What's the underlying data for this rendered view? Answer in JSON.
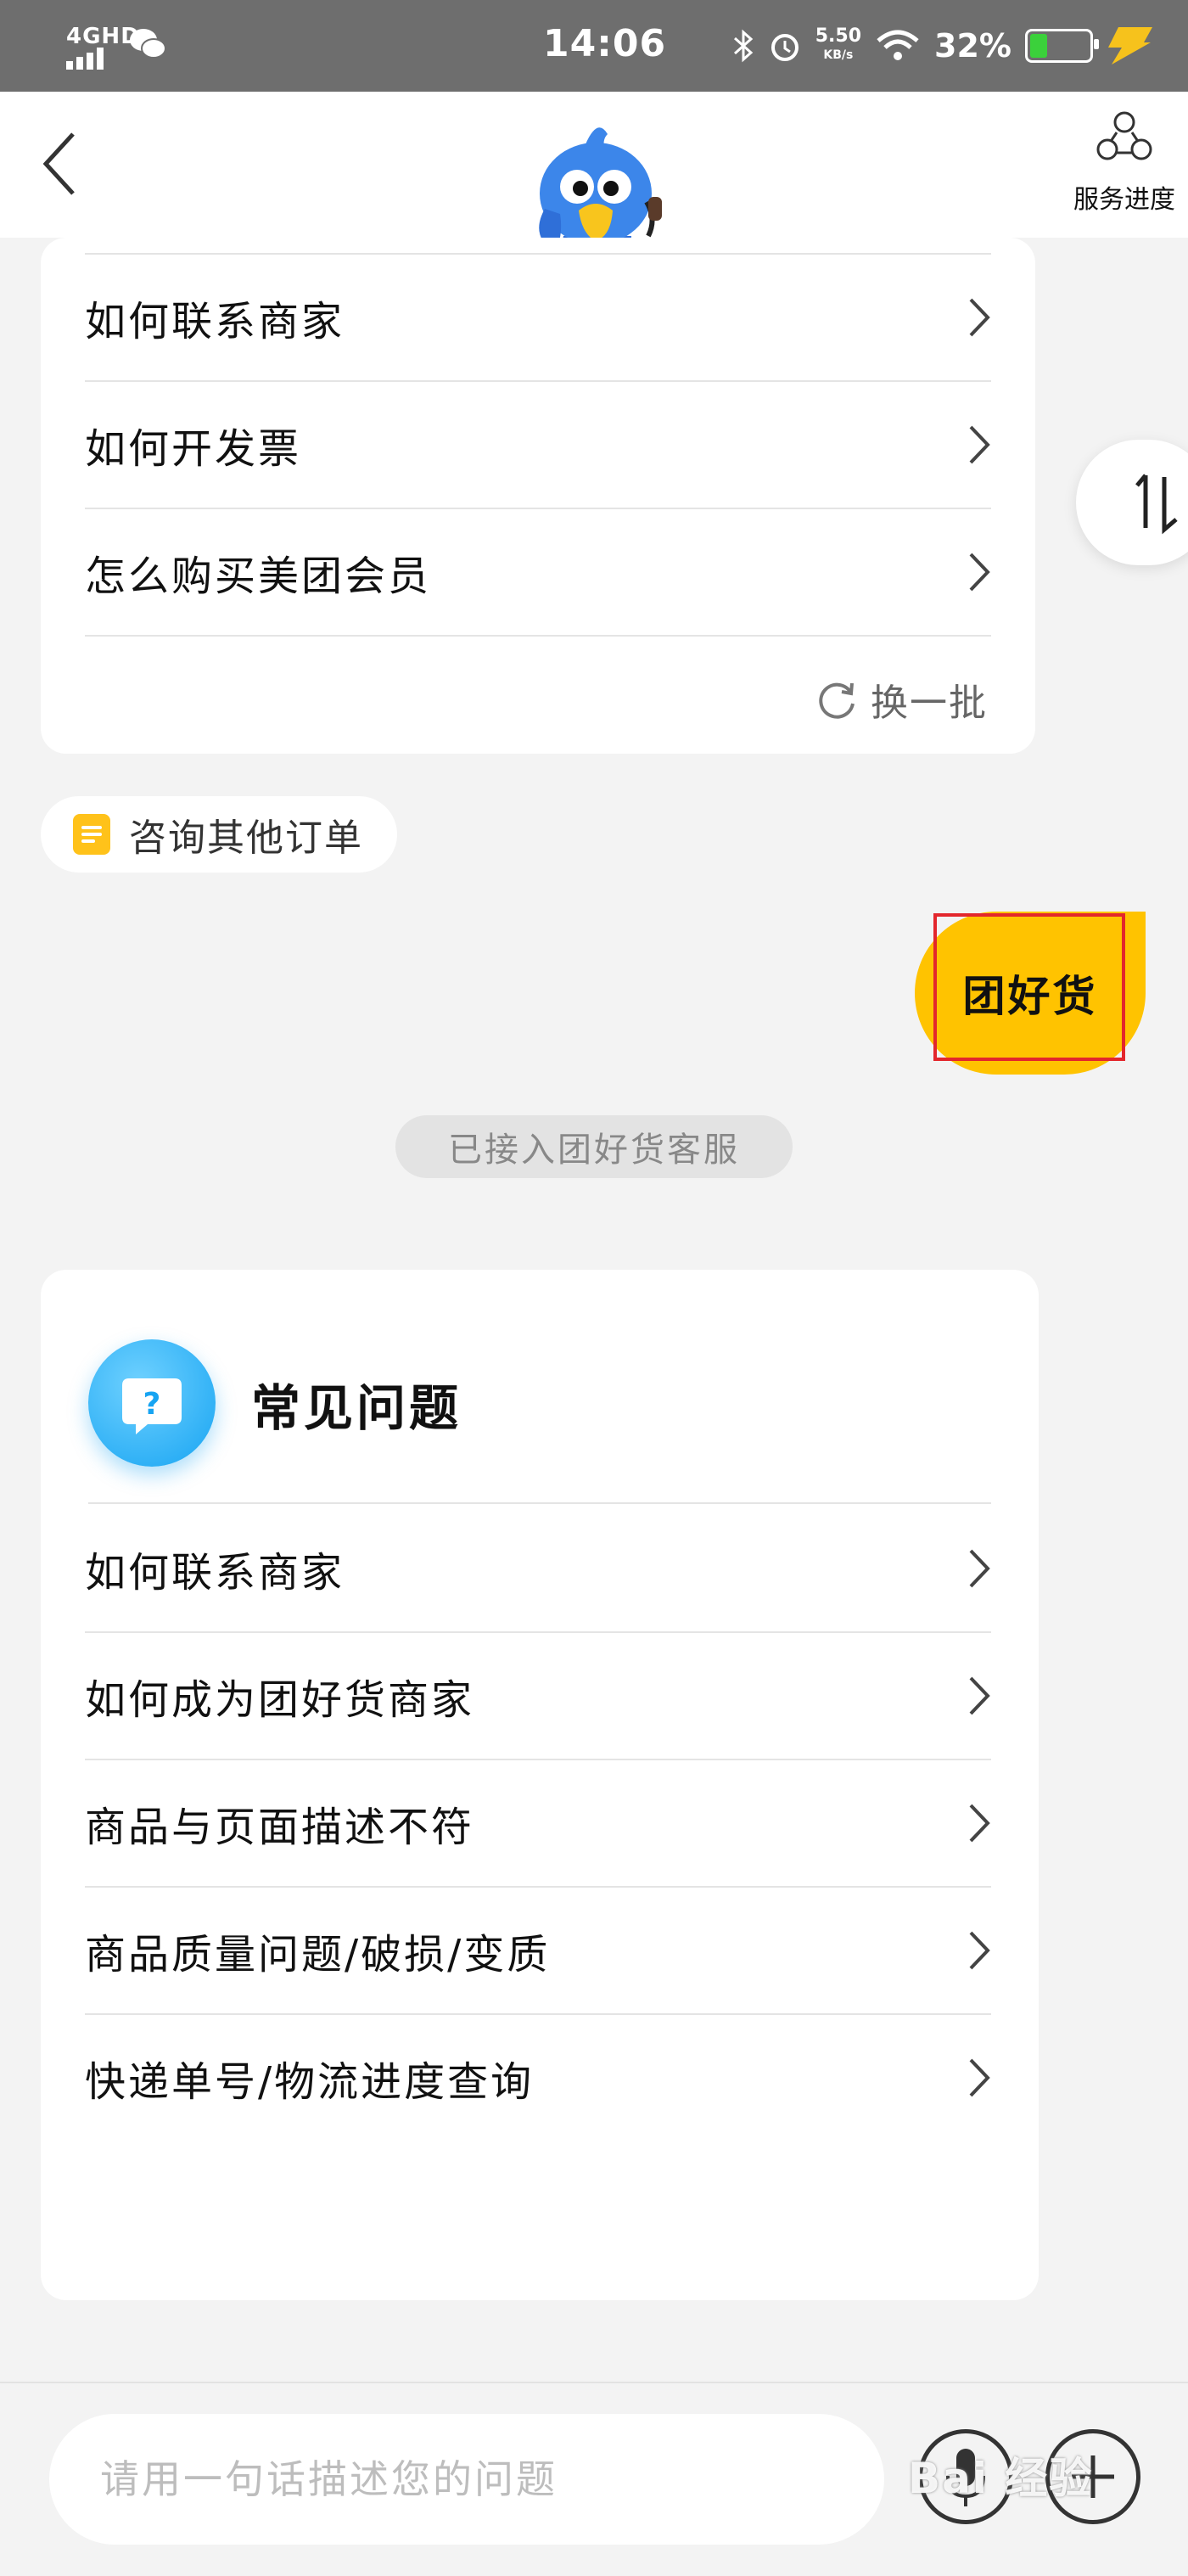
{
  "status_bar": {
    "network": "4GHD",
    "time": "14:06",
    "speed_value": "5.50",
    "speed_unit": "KB/s",
    "battery": "32%",
    "battery_level": 0.32
  },
  "header": {
    "service_progress_label": "服务进度"
  },
  "top_card": {
    "questions": [
      "如何联系商家",
      "如何开发票",
      "怎么购买美团会员"
    ],
    "refresh_label": "换一批"
  },
  "consult_other_orders": "咨询其他订单",
  "user_message": "团好货",
  "system_note": "已接入团好货客服",
  "faq_card": {
    "title": "常见问题",
    "questions": [
      "如何联系商家",
      "如何成为团好货商家",
      "商品与页面描述不符",
      "商品质量问题/破损/变质",
      "快递单号/物流进度查询"
    ]
  },
  "input": {
    "placeholder": "请用一句话描述您的问题"
  },
  "watermark": "Bai 经验",
  "colors": {
    "accent": "#ffc300",
    "highlight_border": "#e3262c",
    "faq_icon": "#17a4f2"
  }
}
